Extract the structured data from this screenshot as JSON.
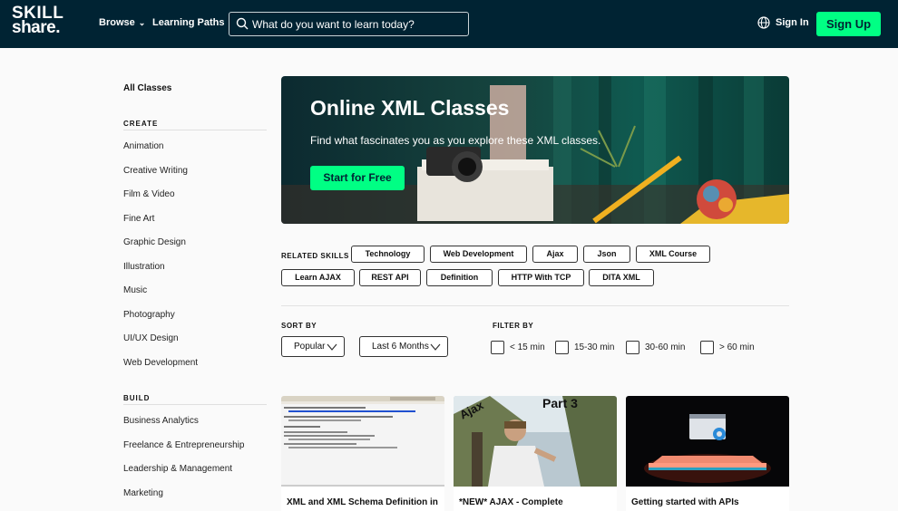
{
  "header": {
    "logo_line1": "SKILL",
    "logo_line2": "share.",
    "browse_label": "Browse",
    "learning_paths_label": "Learning Paths",
    "search_placeholder": "What do you want to learn today?",
    "sign_in_label": "Sign In",
    "sign_up_label": "Sign Up"
  },
  "sidebar": {
    "all_classes": "All Classes",
    "create_heading": "CREATE",
    "create_items": [
      "Animation",
      "Creative Writing",
      "Film & Video",
      "Fine Art",
      "Graphic Design",
      "Illustration",
      "Music",
      "Photography",
      "UI/UX Design",
      "Web Development"
    ],
    "build_heading": "BUILD",
    "build_items": [
      "Business Analytics",
      "Freelance & Entrepreneurship",
      "Leadership & Management",
      "Marketing"
    ]
  },
  "hero": {
    "title": "Online XML Classes",
    "subtitle": "Find what fascinates you as you explore these XML classes.",
    "button_label": "Start for Free"
  },
  "related_skills": {
    "label": "RELATED SKILLS",
    "chips": [
      "Technology",
      "Web Development",
      "Ajax",
      "Json",
      "XML Course",
      "Learn AJAX",
      "REST API",
      "Definition",
      "HTTP With TCP",
      "DITA XML"
    ]
  },
  "sort": {
    "label": "SORT BY",
    "sort_value": "Popular",
    "time_value": "Last 6 Months"
  },
  "filter": {
    "label": "FILTER BY",
    "options": [
      "< 15 min",
      "15-30 min",
      "30-60 min",
      "> 60 min"
    ]
  },
  "cards": [
    {
      "title": "XML and XML Schema Definition in"
    },
    {
      "title": "*NEW* AJAX - Complete",
      "thumb_text_1": "Ajax",
      "thumb_text_2": "Part 3"
    },
    {
      "title": "Getting started with APIs"
    }
  ],
  "colors": {
    "header_bg": "#002333",
    "accent": "#00ff84"
  }
}
